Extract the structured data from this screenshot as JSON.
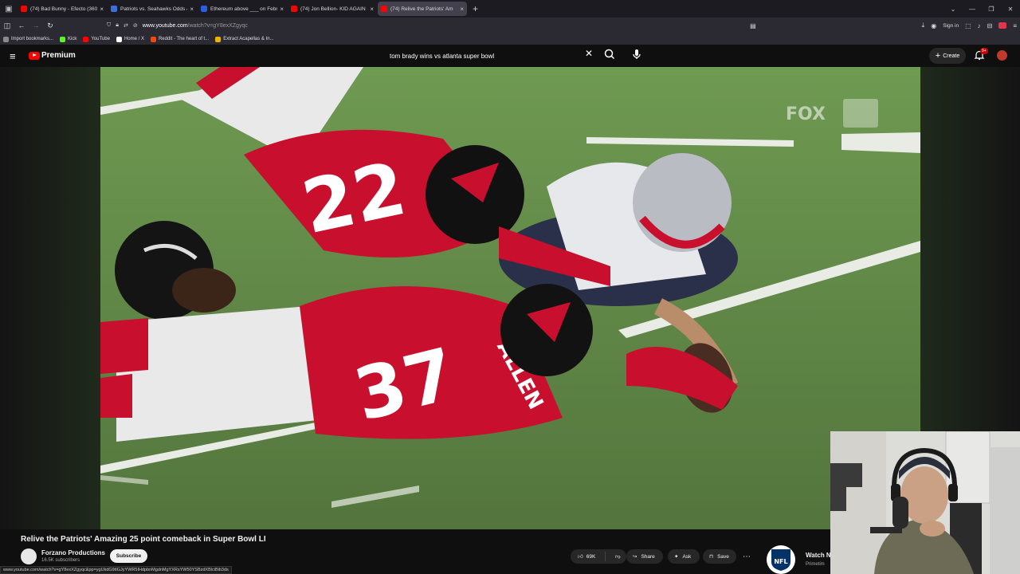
{
  "browser": {
    "tabs": [
      {
        "title": "(74) Bad Bunny - Efecto (360",
        "favicon_color": "#ff0000",
        "active": false
      },
      {
        "title": "Patriots vs. Seahawks Odds & P",
        "favicon_color": "#3b6fe0",
        "active": false
      },
      {
        "title": "Ethereum above ___ on Februar",
        "favicon_color": "#2d5be3",
        "active": false
      },
      {
        "title": "(74) Jon Bellion- KID AGAIN (W",
        "favicon_color": "#ff0000",
        "active": false
      },
      {
        "title": "(74) Relive the Patriots' Am",
        "favicon_color": "#ff0000",
        "active": true
      }
    ],
    "new_tab": "+",
    "url_host": "www.youtube.com",
    "url_path": "/watch?v=gY8exXZgyqc",
    "signin_label": "Sign in",
    "bookmarks": [
      {
        "label": "Import bookmarks...",
        "color": "#8a8a8a"
      },
      {
        "label": "Kick",
        "color": "#53fc18"
      },
      {
        "label": "YouTube",
        "color": "#ff0000"
      },
      {
        "label": "Home / X",
        "color": "#ffffff"
      },
      {
        "label": "Reddit - The heart of t...",
        "color": "#ff4500"
      },
      {
        "label": "Extract Acapellas & In...",
        "color": "#e8b500"
      }
    ]
  },
  "youtube": {
    "logo_text": "Premium",
    "search_query": "tom brady wins vs atlanta super bowl",
    "create_label": "Create",
    "notification_count": "9+",
    "video": {
      "title": "Relive the Patriots' Amazing 25 point comeback in Super Bowl LI",
      "channel_name": "Forzano Productions",
      "subscribers": "16.5K subscribers",
      "subscribe_label": "Subscribe",
      "likes": "69K",
      "share_label": "Share",
      "ask_label": "Ask",
      "save_label": "Save",
      "broadcast_watermark": "FOX",
      "jersey_numbers": [
        "22",
        "37"
      ],
      "jersey_name": "ALLEN"
    },
    "status_url": "www.youtube.com/watch?v=gY8exXZgyqc&pp=ygUkdG9tIGJyYWR5IHdpbnMgdnMgYXRsYW50YSBzdXBlciBib3ds",
    "side_card": {
      "title": "Watch N",
      "subtitle": "Primetim"
    }
  },
  "colors": {
    "brand_red": "#ff0000",
    "field_green": "#5f8447",
    "falcons_red": "#c8102e"
  }
}
